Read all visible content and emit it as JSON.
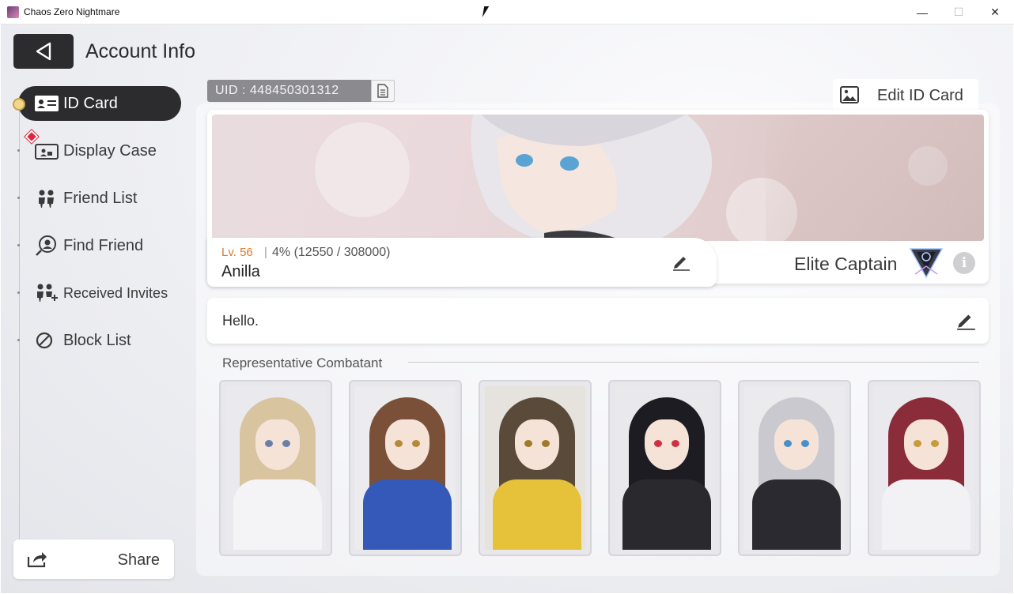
{
  "window": {
    "title": "Chaos Zero Nightmare",
    "minimize": "—",
    "maximize": "☐",
    "close": "✕"
  },
  "header": {
    "back_icon": "back-arrow-icon",
    "title": "Account Info"
  },
  "sidebar": {
    "items": [
      {
        "label": "ID Card",
        "icon": "id-card-icon",
        "active": true
      },
      {
        "label": "Display Case",
        "icon": "display-case-icon",
        "alert": true
      },
      {
        "label": "Friend List",
        "icon": "friends-icon"
      },
      {
        "label": "Find Friend",
        "icon": "find-friend-icon"
      },
      {
        "label": "Received Invites",
        "icon": "invites-icon"
      },
      {
        "label": "Block List",
        "icon": "block-icon"
      }
    ],
    "share_label": "Share"
  },
  "id_card": {
    "uid": "UID : 448450301312",
    "edit_label": "Edit ID Card",
    "level": "Lv. 56",
    "separator": "|",
    "exp": "4% (12550 / 308000)",
    "exp_fraction": 0.04,
    "player_name": "Anilla",
    "title": "Elite Captain",
    "greeting": "Hello."
  },
  "representative": {
    "label": "Representative Combatant",
    "combatants": [
      {
        "hair": "#d9c4a0",
        "body": "#f4f4f6",
        "eyes": "#6a7fa8",
        "bg": "#eaeaee"
      },
      {
        "hair": "#7a5038",
        "body": "#3559b8",
        "eyes": "#b48a3a",
        "bg": "#ececef"
      },
      {
        "hair": "#5a4a3a",
        "body": "#e5c23a",
        "eyes": "#a07a2a",
        "bg": "#e6e3de"
      },
      {
        "hair": "#1c1c22",
        "body": "#2a2a2e",
        "eyes": "#d03040",
        "bg": "#e9e9ec"
      },
      {
        "hair": "#c9c9cf",
        "body": "#2a2a30",
        "eyes": "#4a90c8",
        "bg": "#ebebee"
      },
      {
        "hair": "#8a2c3a",
        "body": "#f2f2f4",
        "eyes": "#c89a3a",
        "bg": "#eaeaee"
      }
    ]
  },
  "colors": {
    "accent_dark": "#2c2c2e",
    "level_orange": "#e07a2a",
    "alert_red": "#e0243c"
  }
}
